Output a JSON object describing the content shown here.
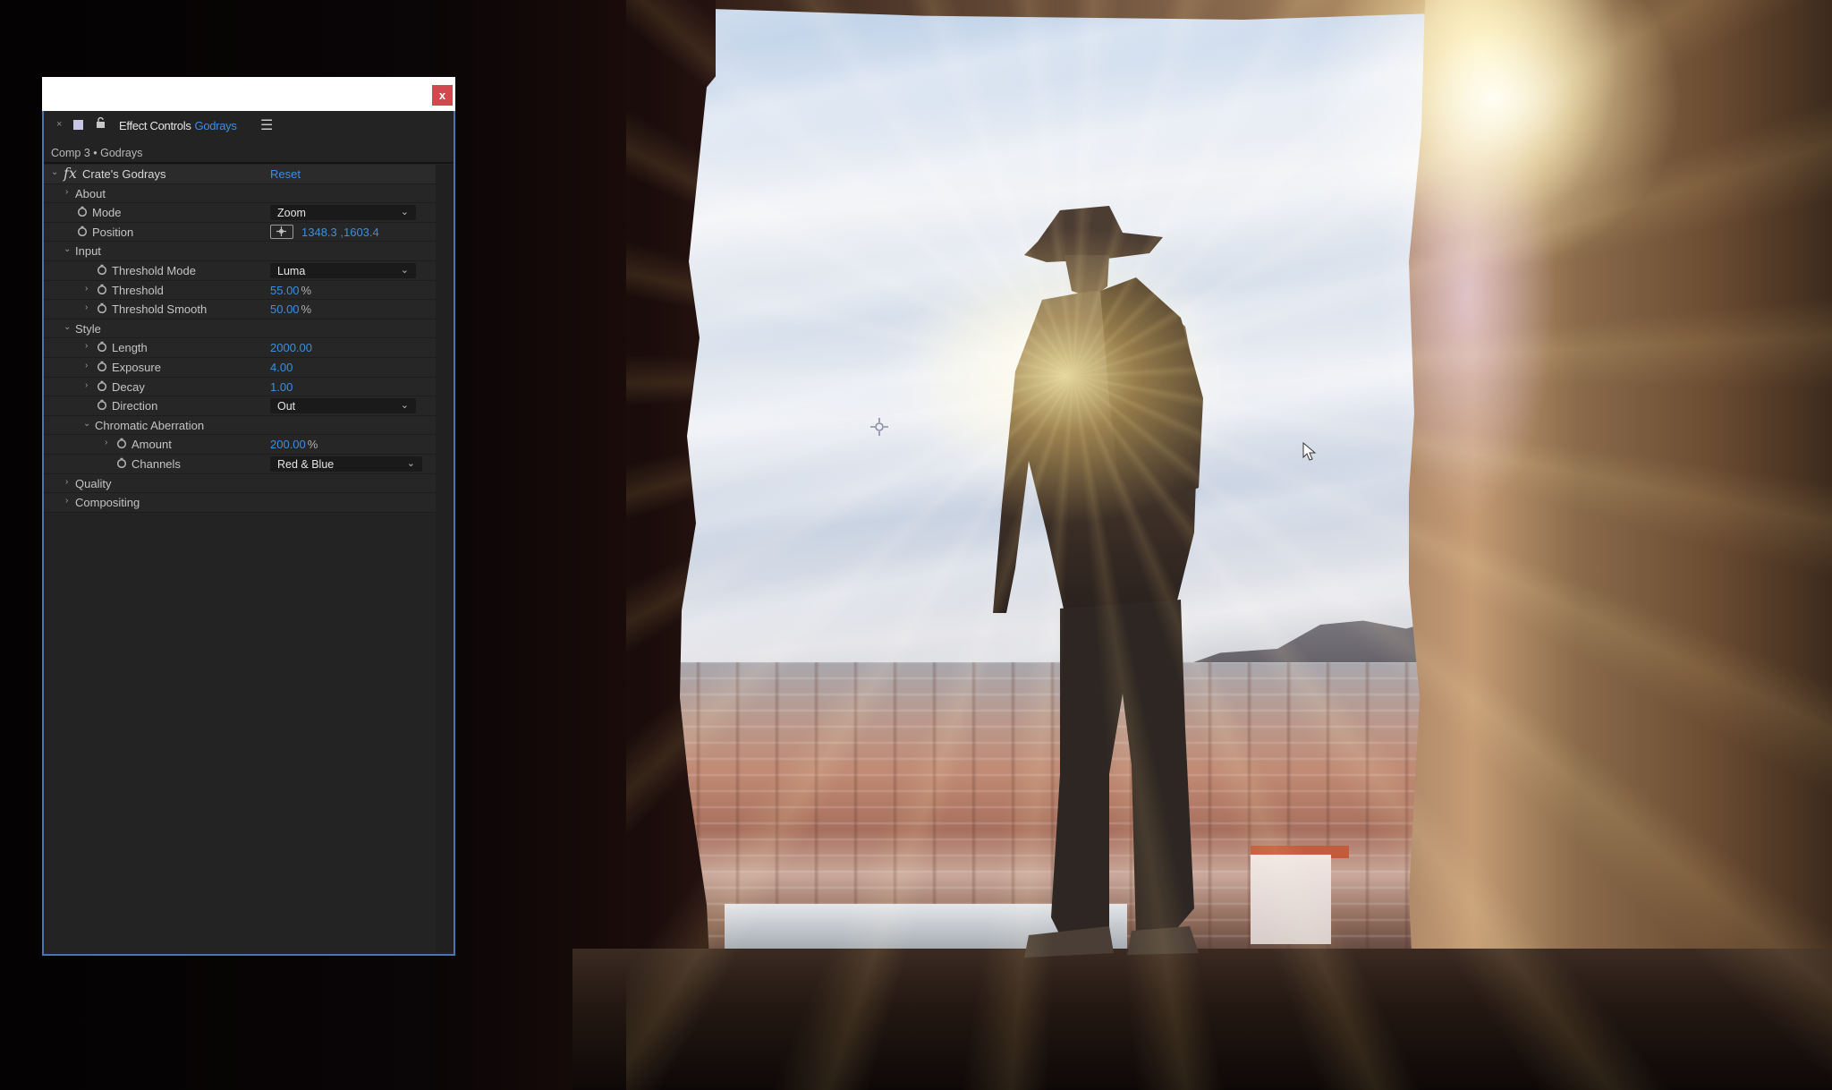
{
  "window": {
    "close_label": "x"
  },
  "panel": {
    "tab_close": "×",
    "tab_title": "Effect Controls",
    "tab_layer": "Godrays",
    "menu_icon": "☰",
    "breadcrumb": "Comp 3 • Godrays"
  },
  "effect": {
    "name": "Crate's Godrays",
    "reset_label": "Reset",
    "fx_glyph": "fx"
  },
  "params": {
    "about": {
      "label": "About"
    },
    "mode": {
      "label": "Mode",
      "value": "Zoom"
    },
    "position": {
      "label": "Position",
      "value": "1348.3 ,1603.4"
    },
    "input": {
      "label": "Input"
    },
    "threshold_mode": {
      "label": "Threshold Mode",
      "value": "Luma"
    },
    "threshold": {
      "label": "Threshold",
      "value": "55.00",
      "unit": "%"
    },
    "threshold_smooth": {
      "label": "Threshold Smooth",
      "value": "50.00",
      "unit": "%"
    },
    "style": {
      "label": "Style"
    },
    "length": {
      "label": "Length",
      "value": "2000.00"
    },
    "exposure": {
      "label": "Exposure",
      "value": "4.00"
    },
    "decay": {
      "label": "Decay",
      "value": "1.00"
    },
    "direction": {
      "label": "Direction",
      "value": "Out"
    },
    "chromatic_aberration": {
      "label": "Chromatic Aberration"
    },
    "amount": {
      "label": "Amount",
      "value": "200.00",
      "unit": "%"
    },
    "channels": {
      "label": "Channels",
      "value": "Red & Blue"
    },
    "quality": {
      "label": "Quality"
    },
    "compositing": {
      "label": "Compositing"
    }
  },
  "glyphs": {
    "expand": "›",
    "collapse": "⌄",
    "dropdown": "⌄"
  },
  "colors": {
    "accent_blue": "#3d8ee0",
    "panel_bg": "#232323",
    "window_border": "#4a75b0",
    "close_red": "#d2484f"
  }
}
